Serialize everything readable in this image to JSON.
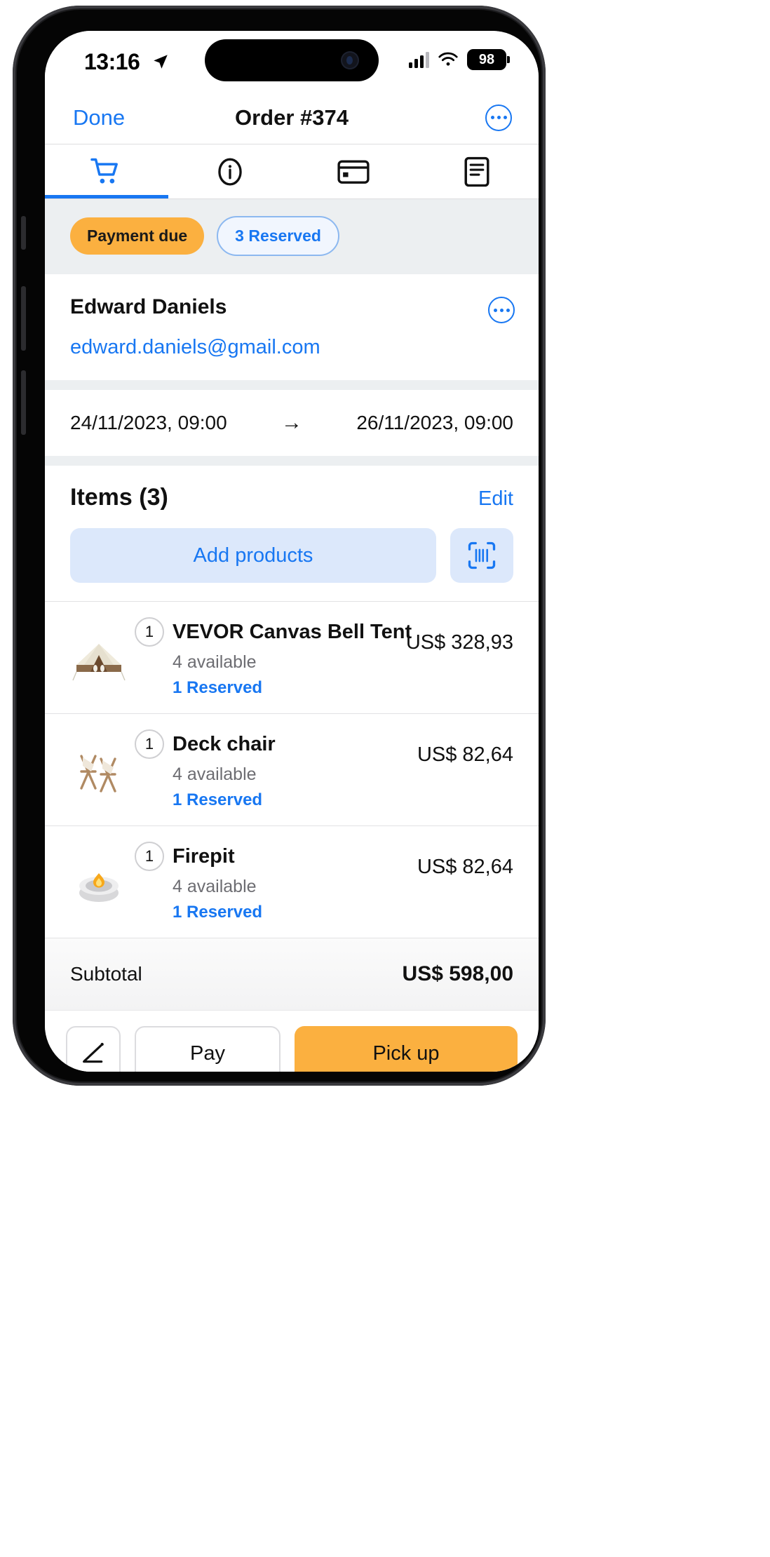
{
  "status_bar": {
    "time": "13:16",
    "location_icon": "location-arrow-icon",
    "signal_icon": "cellular-signal-icon",
    "wifi_icon": "wifi-icon",
    "battery_level": "98"
  },
  "nav": {
    "left_label": "Done",
    "title": "Order #374",
    "more_icon": "ellipsis-circle-icon"
  },
  "tabs": [
    {
      "name": "cart",
      "icon": "shopping-cart-icon",
      "active": true
    },
    {
      "name": "info",
      "icon": "info-circle-icon",
      "active": false
    },
    {
      "name": "payment",
      "icon": "credit-card-icon",
      "active": false
    },
    {
      "name": "documents",
      "icon": "document-icon",
      "active": false
    }
  ],
  "chips": [
    {
      "label": "Payment due",
      "style": "warning",
      "color": "#fbb040"
    },
    {
      "label": "3 Reserved",
      "style": "info",
      "color": "#1877f2"
    }
  ],
  "customer": {
    "name": "Edward Daniels",
    "email": "edward.daniels@gmail.com",
    "more_icon": "ellipsis-circle-icon"
  },
  "dates": {
    "start": "24/11/2023, 09:00",
    "arrow": "→",
    "end": "26/11/2023, 09:00"
  },
  "items_section": {
    "title": "Items  (3)",
    "edit_label": "Edit",
    "add_products_label": "Add products",
    "scan_icon": "barcode-scan-icon"
  },
  "items": [
    {
      "qty": "1",
      "name": "VEVOR Canvas Bell Tent",
      "available": "4 available",
      "reserved": "1 Reserved",
      "price": "US$ 328,93",
      "thumb": "tent-thumbnail"
    },
    {
      "qty": "1",
      "name": "Deck chair",
      "available": "4 available",
      "reserved": "1 Reserved",
      "price": "US$ 82,64",
      "thumb": "deck-chair-thumbnail"
    },
    {
      "qty": "1",
      "name": "Firepit",
      "available": "4 available",
      "reserved": "1 Reserved",
      "price": "US$ 82,64",
      "thumb": "firepit-thumbnail"
    }
  ],
  "subtotal": {
    "label": "Subtotal",
    "value": "US$ 598,00"
  },
  "bottom_bar": {
    "sign_icon": "signature-icon",
    "pay_label": "Pay",
    "pickup_label": "Pick up",
    "pickup_color": "#fbb040"
  }
}
